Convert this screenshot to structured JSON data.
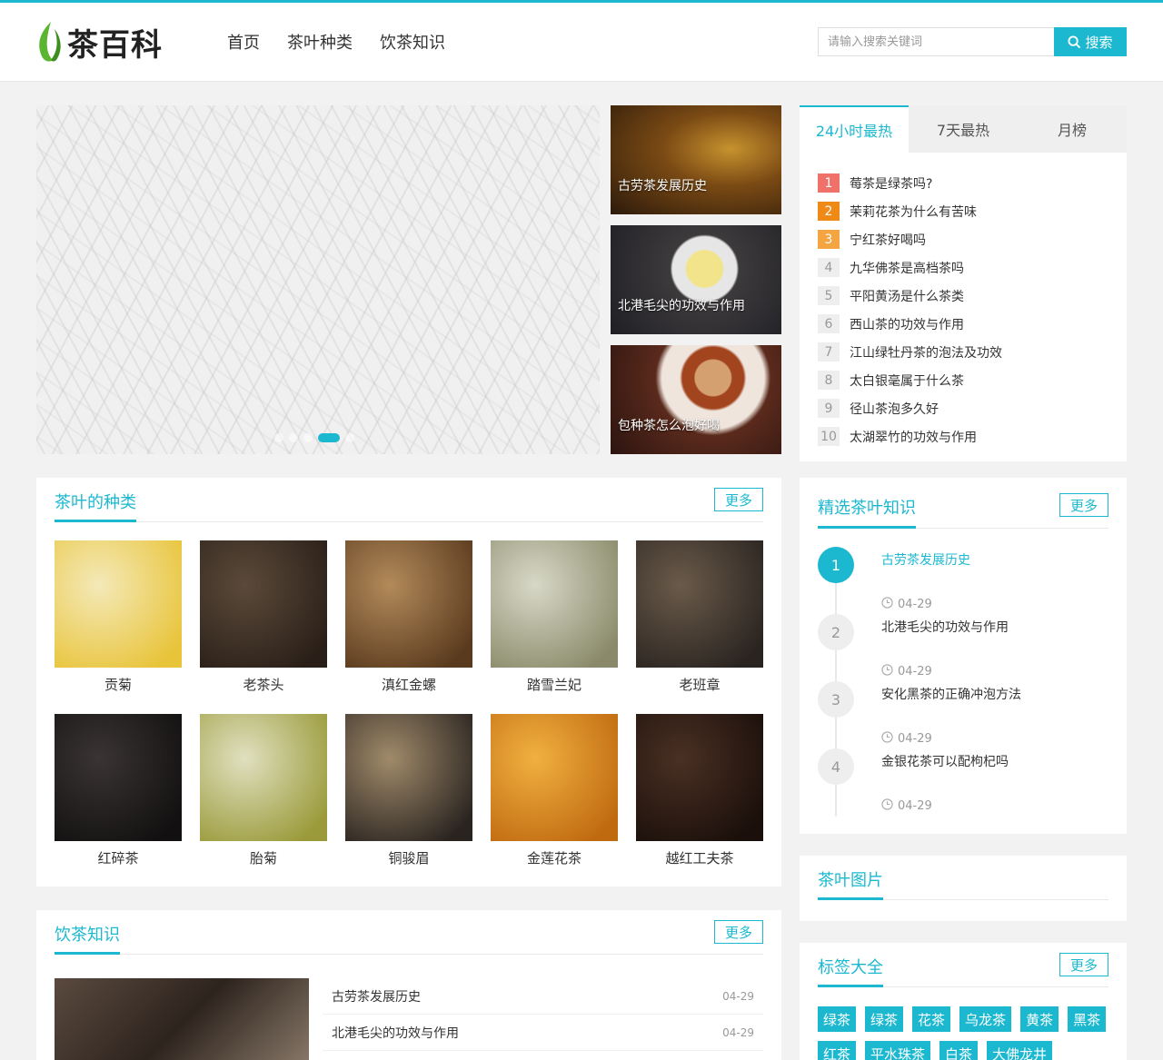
{
  "header": {
    "logo_text": "茶百科",
    "nav": [
      "首页",
      "茶叶种类",
      "饮茶知识"
    ],
    "search_placeholder": "请输入搜索关键词",
    "search_button": "搜索"
  },
  "slider": {
    "dot_count": 5,
    "active_dot": 4
  },
  "featured": [
    "古劳茶发展历史",
    "北港毛尖的功效与作用",
    "包种茶怎么泡好喝"
  ],
  "hot": {
    "tabs": [
      "24小时最热",
      "7天最热",
      "月榜"
    ],
    "active_tab": 0,
    "items": [
      {
        "rank": "1",
        "title": "莓茶是绿茶吗?"
      },
      {
        "rank": "2",
        "title": "茉莉花茶为什么有苦味"
      },
      {
        "rank": "3",
        "title": "宁红茶好喝吗"
      },
      {
        "rank": "4",
        "title": "九华佛茶是高档茶吗"
      },
      {
        "rank": "5",
        "title": "平阳黄汤是什么茶类"
      },
      {
        "rank": "6",
        "title": "西山茶的功效与作用"
      },
      {
        "rank": "7",
        "title": "江山绿牡丹茶的泡法及功效"
      },
      {
        "rank": "8",
        "title": "太白银毫属于什么茶"
      },
      {
        "rank": "9",
        "title": "径山茶泡多久好"
      },
      {
        "rank": "10",
        "title": "太湖翠竹的功效与作用"
      }
    ]
  },
  "tea_types": {
    "title": "茶叶的种类",
    "more": "更多",
    "items": [
      {
        "name": "贡菊",
        "color1": "#f4e9b8",
        "color2": "#e8c43a"
      },
      {
        "name": "老茶头",
        "color1": "#5b4a3a",
        "color2": "#2a1f18"
      },
      {
        "name": "滇红金螺",
        "color1": "#b28a5a",
        "color2": "#5a3a1e"
      },
      {
        "name": "踏雪兰妃",
        "color1": "#d8d8c8",
        "color2": "#8a8a6a"
      },
      {
        "name": "老班章",
        "color1": "#6a5a4a",
        "color2": "#2a2420"
      },
      {
        "name": "红碎茶",
        "color1": "#3a3434",
        "color2": "#121010"
      },
      {
        "name": "胎菊",
        "color1": "#e0e0c0",
        "color2": "#9a9a3a"
      },
      {
        "name": "铜骏眉",
        "color1": "#a08a6a",
        "color2": "#2a2420"
      },
      {
        "name": "金莲花茶",
        "color1": "#f0b040",
        "color2": "#c06a10"
      },
      {
        "name": "越红工夫茶",
        "color1": "#4a3024",
        "color2": "#1a0f0a"
      }
    ]
  },
  "knowledge": {
    "title": "饮茶知识",
    "more": "更多",
    "items": [
      {
        "title": "古劳茶发展历史",
        "date": "04-29"
      },
      {
        "title": "北港毛尖的功效与作用",
        "date": "04-29"
      }
    ]
  },
  "picks": {
    "title": "精选茶叶知识",
    "more": "更多",
    "items": [
      {
        "num": "1",
        "title": "古劳茶发展历史",
        "date": "04-29"
      },
      {
        "num": "2",
        "title": "北港毛尖的功效与作用",
        "date": "04-29"
      },
      {
        "num": "3",
        "title": "安化黑茶的正确冲泡方法",
        "date": "04-29"
      },
      {
        "num": "4",
        "title": "金银花茶可以配枸杞吗",
        "date": "04-29"
      }
    ]
  },
  "pictures": {
    "title": "茶叶图片"
  },
  "tags": {
    "title": "标签大全",
    "more": "更多",
    "items": [
      "绿茶",
      "绿茶",
      "花茶",
      "乌龙茶",
      "黄茶",
      "黑茶",
      "红茶",
      "平水珠茶",
      "白茶",
      "大佛龙井"
    ]
  },
  "colors": {
    "accent": "#1bb8d0",
    "rank1": "#f0706a",
    "rank2": "#f08a16",
    "rank3": "#f5a442"
  }
}
